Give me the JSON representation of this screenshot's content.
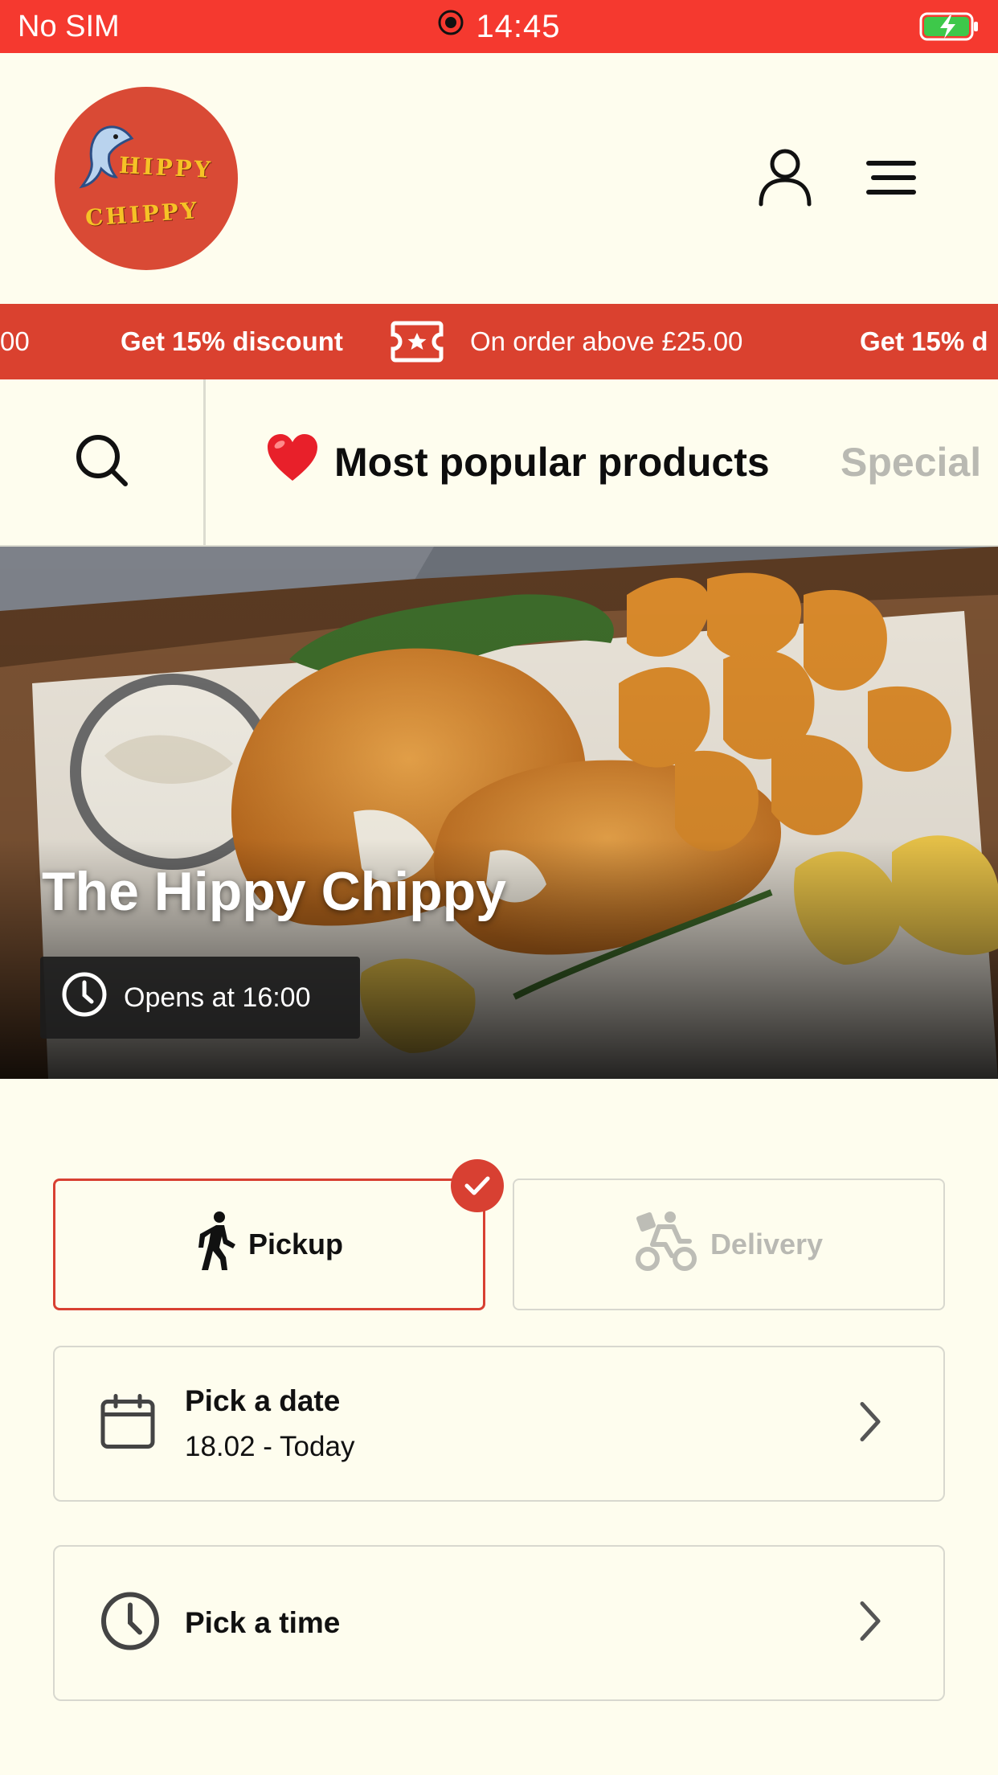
{
  "status_bar": {
    "carrier": "No SIM",
    "time": "14:45",
    "icons": [
      "recording-icon",
      "battery-charging-icon"
    ]
  },
  "header": {
    "logo_line1": "HIPPY",
    "logo_line2": "CHIPPY",
    "icons": [
      "user-icon",
      "menu-icon"
    ]
  },
  "promo": {
    "leading_fragment": "00",
    "headline": "Get 15% discount",
    "condition": "On order above £25.00",
    "trailing_fragment": "Get 15% d"
  },
  "tabs": {
    "search_icon": "search-icon",
    "popular_emoji": "❤️",
    "popular_label": "Most popular products",
    "next_label": "Special"
  },
  "hero": {
    "title": "The Hippy Chippy",
    "opening": "Opens at 16:00"
  },
  "fulfillment": {
    "pickup_label": "Pickup",
    "delivery_label": "Delivery",
    "selected": "Pickup"
  },
  "pick_date": {
    "title": "Pick a date",
    "value": "18.02 - Today"
  },
  "pick_time": {
    "title": "Pick a time"
  },
  "colors": {
    "accent": "#d84032",
    "status_bar": "#f5392f",
    "background": "#fefdee",
    "muted": "#b9b9b3"
  }
}
